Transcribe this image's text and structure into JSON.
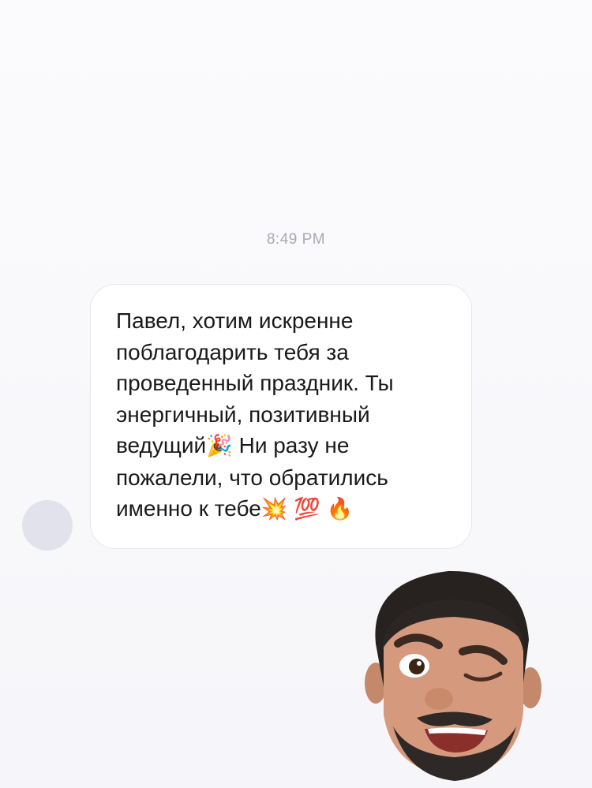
{
  "chat": {
    "timestamp": "8:49 PM",
    "message": {
      "lines": [
        "Павел, хотим искренне",
        "поблагодарить тебя за",
        "проведенный праздник. Ты",
        "энергичный, позитивный",
        "ведущий",
        " Ни разу не",
        "пожалели, что обратились",
        "именно к тебе"
      ],
      "emojis": {
        "party": "🎉",
        "collision": "💥",
        "hundred": "💯",
        "fire": "🔥"
      }
    },
    "sender_avatar_icon": "avatar-placeholder-icon",
    "sticker_icon": "winking-memoji-icon"
  },
  "colors": {
    "background": "#f7f7fb",
    "bubble": "#ffffff",
    "bubble_border": "#e6e6ee",
    "text": "#1a1a1a",
    "timestamp": "#a9a9b3",
    "avatar": "#e2e2ec"
  }
}
